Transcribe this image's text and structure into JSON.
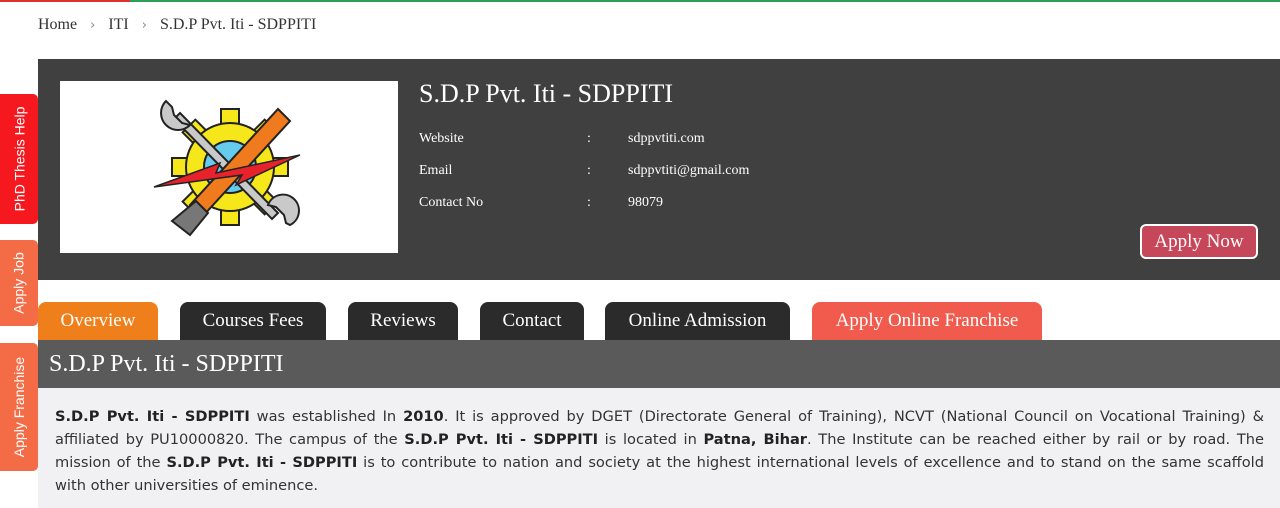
{
  "breadcrumb": {
    "home": "Home",
    "iti": "ITI",
    "current": "S.D.P Pvt. Iti - SDPPITI"
  },
  "side_tabs": {
    "phd": "PhD Thesis Help",
    "job": "Apply Job",
    "franchise": "Apply Franchise"
  },
  "institute": {
    "name": "S.D.P Pvt. Iti - SDPPITI",
    "website_label": "Website",
    "website": "sdppvtiti.com",
    "email_label": "Email",
    "email": "sdppvtiti@gmail.com",
    "contact_label": "Contact No",
    "contact": "98079",
    "colon": ":",
    "apply_label": "Apply Now"
  },
  "tabs": {
    "overview": "Overview",
    "fees": "Courses Fees",
    "reviews": "Reviews",
    "contact": "Contact",
    "admission": "Online Admission",
    "franchise": "Apply Online Franchise"
  },
  "section_title": "S.D.P Pvt. Iti - SDPPITI",
  "about": {
    "name": "S.D.P Pvt. Iti - SDPPITI",
    "t1": " was established In ",
    "year": "2010",
    "t2": ". It is approved by DGET (Directorate General of Training), NCVT (National Council on Vocational Training) & affiliated by PU10000820. The campus of the ",
    "t3": " is located in ",
    "location": "Patna, Bihar",
    "t4": ". The Institute can be reached either by rail or by road. The mission of the ",
    "t5": " is to contribute to nation and society at the highest international levels of excellence and to stand on the same scaffold with other universities of eminence."
  },
  "colors": {
    "hero_bg": "#404040",
    "overview_tab": "#ef7f1a",
    "franchise_tab": "#f15b4e",
    "apply_btn": "#c7475a",
    "phd_tab": "#f5181f"
  },
  "icons": {
    "logo": "wrench-gear-lightning-logo",
    "breadcrumb_sep": "chevron-right-icon"
  }
}
